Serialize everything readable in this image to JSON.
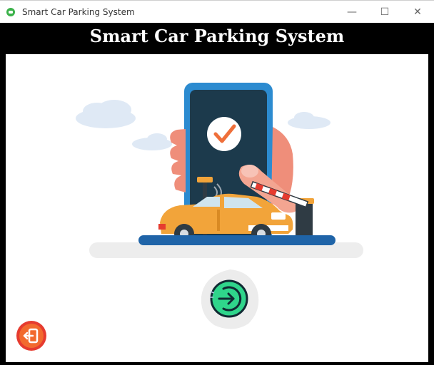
{
  "window": {
    "title": "Smart Car Parking System",
    "controls": {
      "minimize": "—",
      "maximize": "☐",
      "close": "✕"
    }
  },
  "header": {
    "title": "Smart Car Parking System"
  },
  "icons": {
    "app": "android-icon",
    "check": "checkmark-icon",
    "enter": "login-arrow-icon",
    "exit": "exit-door-icon"
  },
  "colors": {
    "phone_frame": "#2c8bd0",
    "phone_screen": "#1c3a4c",
    "car_body": "#f2a43a",
    "enter_green": "#2fd58b",
    "exit_red": "#e63b2f",
    "hand_skin": "#ef8e7a",
    "road_blue": "#1f64a8"
  }
}
